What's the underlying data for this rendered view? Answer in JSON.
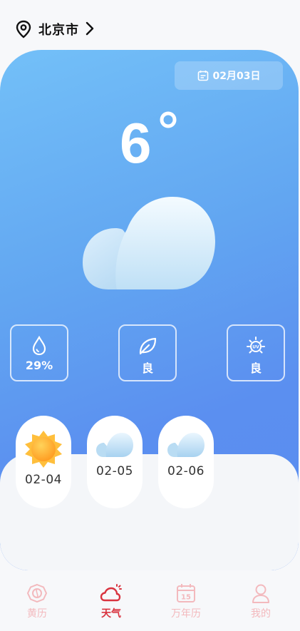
{
  "header": {
    "city": "北京市"
  },
  "weather": {
    "date": "02月03日",
    "temperature": "6"
  },
  "stats": [
    {
      "icon": "humidity-drop-icon",
      "value": "29%"
    },
    {
      "icon": "leaf-air-quality-icon",
      "value": "良"
    },
    {
      "icon": "uv-sun-icon",
      "value": "良"
    }
  ],
  "forecast": [
    {
      "date": "02-04",
      "icon": "sun-icon"
    },
    {
      "date": "02-05",
      "icon": "cloud-icon"
    },
    {
      "date": "02-06",
      "icon": "cloud-icon"
    }
  ],
  "nav": [
    {
      "label": "黄历",
      "icon": "almanac-icon"
    },
    {
      "label": "天气",
      "icon": "weather-icon",
      "active": true
    },
    {
      "label": "万年历",
      "icon": "calendar-icon"
    },
    {
      "label": "我的",
      "icon": "profile-icon"
    }
  ],
  "colors": {
    "accent": "#d9333f",
    "card_start": "#73c0f8",
    "card_end": "#5a8def",
    "nav_inactive": "#f3b9bd"
  }
}
